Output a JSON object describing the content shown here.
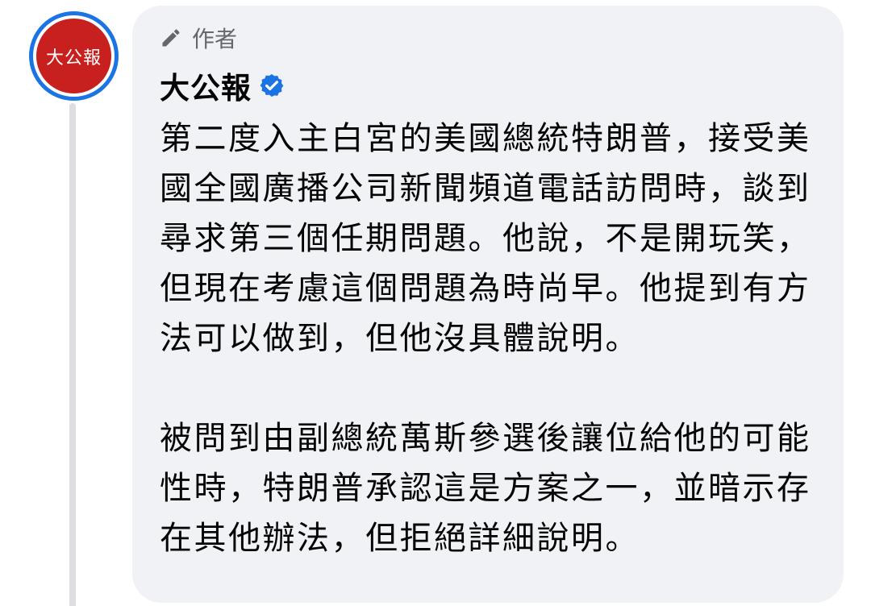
{
  "author": {
    "badge_label": "作者",
    "name": "大公報",
    "avatar_text": "大公報",
    "verified_icon": "verified-badge-icon",
    "badge_icon": "pencil-icon"
  },
  "post": {
    "paragraph_1": "第二度入主白宮的美國總統特朗普，接受美國全國廣播公司新聞頻道電話訪問時，談到尋求第三個任期問題。他說，不是開玩笑，但現在考慮這個問題為時尚早。他提到有方法可以做到，但他沒具體說明。",
    "paragraph_2": "被問到由副總統萬斯參選後讓位給他的可能性時，特朗普承認這是方案之一，並暗示存在其他辦法，但拒絕詳細說明。"
  },
  "colors": {
    "avatar_ring": "#1b74e4",
    "avatar_bg": "#c8201e",
    "bubble_bg": "#f0f2f5",
    "verified": "#1b74e4",
    "secondary_text": "#65676b"
  }
}
